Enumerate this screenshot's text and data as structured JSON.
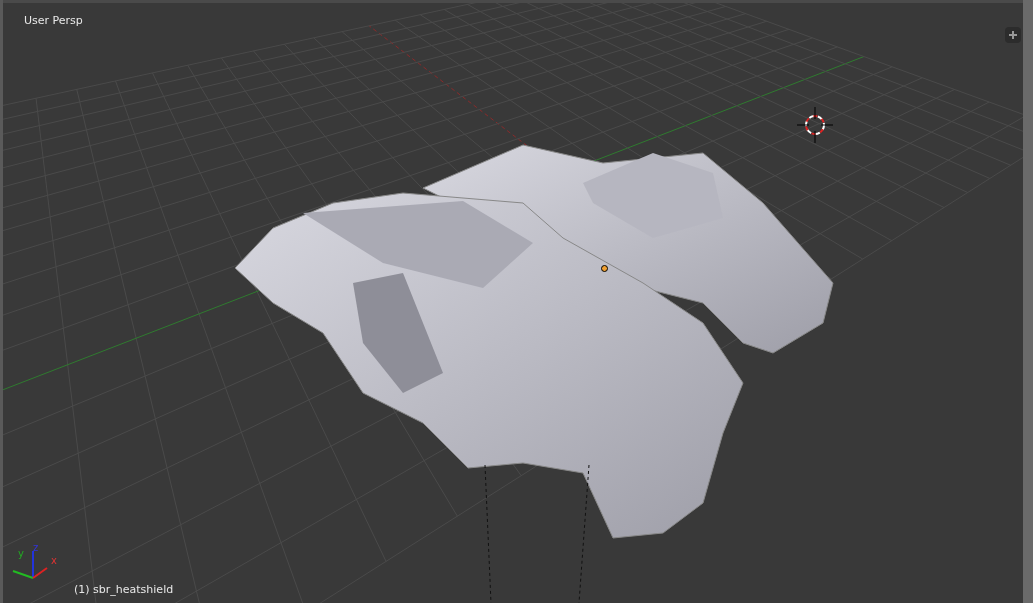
{
  "viewport": {
    "view_name": "User Persp",
    "active_object": "(1) sbr_heatshield",
    "axis_labels": [
      "x",
      "y",
      "z"
    ]
  }
}
